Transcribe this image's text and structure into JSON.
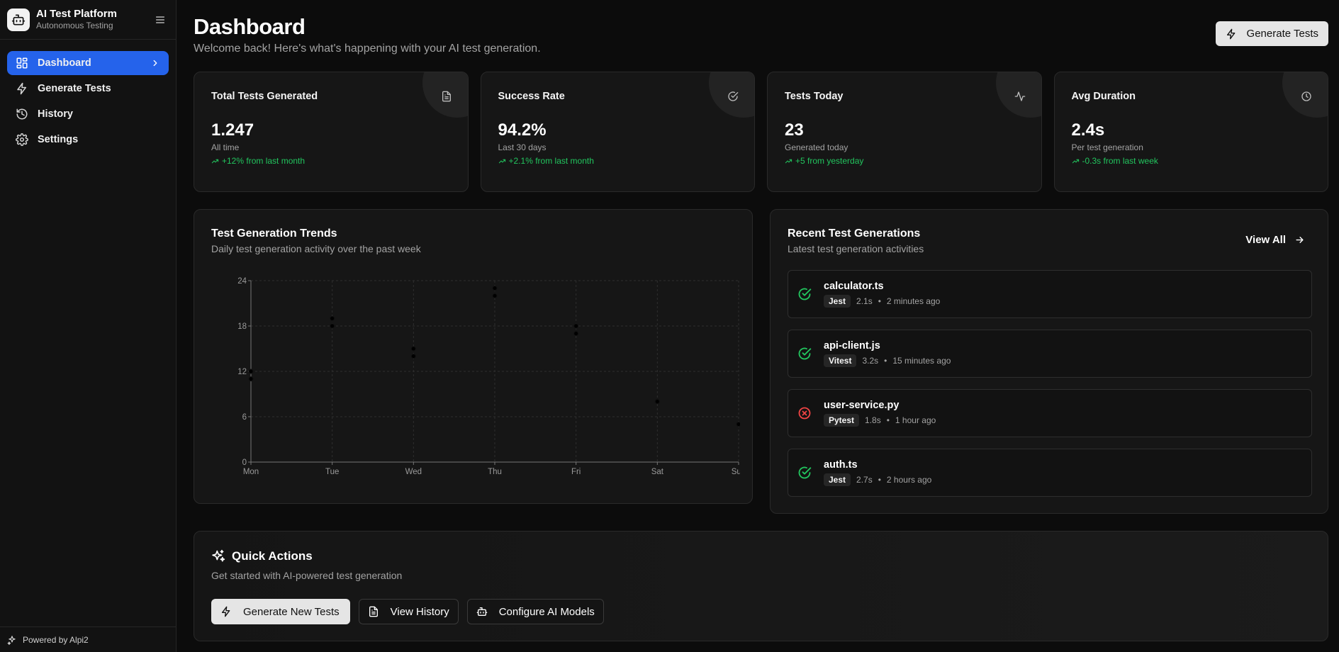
{
  "brand": {
    "title": "AI Test Platform",
    "subtitle": "Autonomous Testing"
  },
  "nav": [
    {
      "label": "Dashboard",
      "icon": "grid-icon",
      "active": true
    },
    {
      "label": "Generate Tests",
      "icon": "bolt-icon",
      "active": false
    },
    {
      "label": "History",
      "icon": "history-icon",
      "active": false
    },
    {
      "label": "Settings",
      "icon": "gear-icon",
      "active": false
    }
  ],
  "footer": {
    "label": "Powered by Alpi2"
  },
  "header": {
    "title": "Dashboard",
    "subtitle": "Welcome back! Here's what's happening with your AI test generation.",
    "action_label": "Generate Tests"
  },
  "stats": [
    {
      "title": "Total Tests Generated",
      "value": "1.247",
      "sub": "All time",
      "change": "+12% from last month",
      "icon": "document-icon"
    },
    {
      "title": "Success Rate",
      "value": "94.2%",
      "sub": "Last 30 days",
      "change": "+2.1% from last month",
      "icon": "check-circle-icon"
    },
    {
      "title": "Tests Today",
      "value": "23",
      "sub": "Generated today",
      "change": "+5 from yesterday",
      "icon": "activity-icon"
    },
    {
      "title": "Avg Duration",
      "value": "2.4s",
      "sub": "Per test generation",
      "change": "-0.3s from last week",
      "icon": "clock-icon"
    }
  ],
  "trends": {
    "title": "Test Generation Trends",
    "subtitle": "Daily test generation activity over the past week"
  },
  "chart_data": {
    "type": "scatter",
    "categories": [
      "Mon",
      "Tue",
      "Wed",
      "Thu",
      "Fri",
      "Sat",
      "Sun"
    ],
    "series": [
      {
        "values": [
          12,
          19,
          15,
          23,
          18,
          8,
          5
        ]
      },
      {
        "values": [
          11,
          18,
          14,
          22,
          17,
          8,
          5
        ]
      }
    ],
    "ylim": [
      0,
      24
    ],
    "yticks": [
      0,
      6,
      12,
      18,
      24
    ],
    "grid": true
  },
  "recent": {
    "title": "Recent Test Generations",
    "subtitle": "Latest test generation activities",
    "view_all": "View All",
    "items": [
      {
        "name": "calculator.ts",
        "framework": "Jest",
        "duration": "2.1s",
        "time": "2 minutes ago",
        "status": "success"
      },
      {
        "name": "api-client.js",
        "framework": "Vitest",
        "duration": "3.2s",
        "time": "15 minutes ago",
        "status": "success"
      },
      {
        "name": "user-service.py",
        "framework": "Pytest",
        "duration": "1.8s",
        "time": "1 hour ago",
        "status": "failed"
      },
      {
        "name": "auth.ts",
        "framework": "Jest",
        "duration": "2.7s",
        "time": "2 hours ago",
        "status": "success"
      }
    ]
  },
  "quick": {
    "title": "Quick Actions",
    "subtitle": "Get started with AI-powered test generation",
    "buttons": [
      {
        "label": "Generate New Tests",
        "icon": "bolt-icon"
      },
      {
        "label": "View History",
        "icon": "document-icon"
      },
      {
        "label": "Configure AI Models",
        "icon": "robot-icon"
      }
    ]
  },
  "colors": {
    "accent": "#2563eb",
    "success": "#22c55e",
    "error": "#ef4444"
  }
}
